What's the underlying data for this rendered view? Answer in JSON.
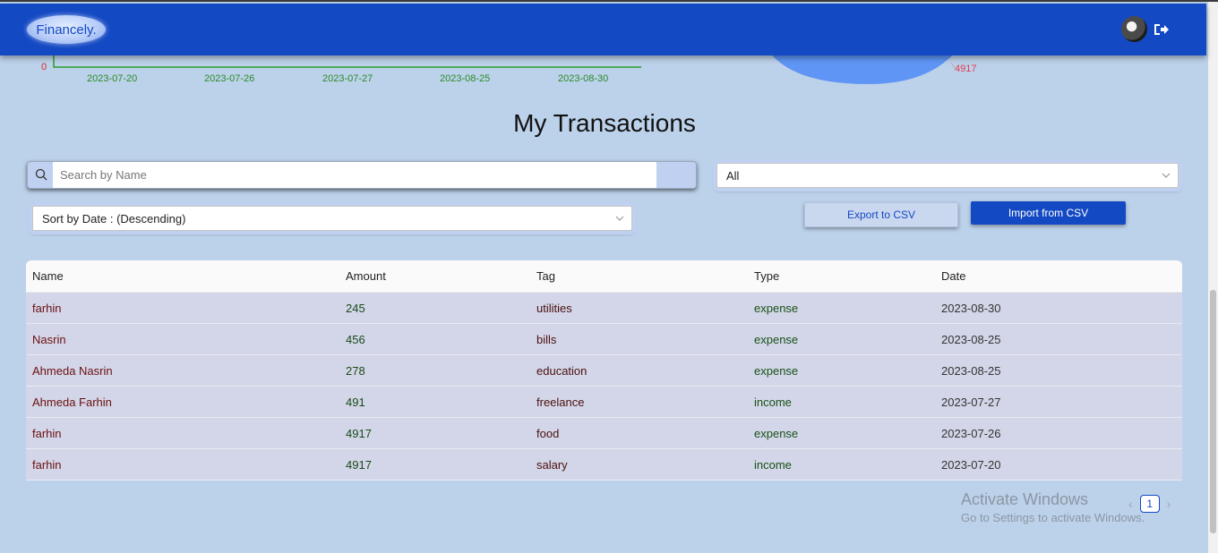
{
  "header": {
    "logo_text": "Financely.",
    "avatar_icon": "user-avatar-icon",
    "logout_icon": "logout-icon",
    "brand_color": "#1449c4"
  },
  "chart_fragment": {
    "y_zero_label": "0",
    "dates": [
      "2023-07-20",
      "2023-07-26",
      "2023-07-27",
      "2023-08-25",
      "2023-08-30"
    ],
    "pie_label": "4917"
  },
  "page_title": "My Transactions",
  "search": {
    "placeholder": "Search by Name",
    "value": ""
  },
  "filter": {
    "selected": "All"
  },
  "sort": {
    "selected": "Sort by Date : (Descending)"
  },
  "buttons": {
    "export": "Export to CSV",
    "import": "Import from CSV"
  },
  "table": {
    "headers": [
      "Name",
      "Amount",
      "Tag",
      "Type",
      "Date"
    ],
    "rows": [
      [
        "farhin",
        "245",
        "utilities",
        "expense",
        "2023-08-30"
      ],
      [
        "Nasrin",
        "456",
        "bills",
        "expense",
        "2023-08-25"
      ],
      [
        "Ahmeda Nasrin",
        "278",
        "education",
        "expense",
        "2023-08-25"
      ],
      [
        "Ahmeda Farhin",
        "491",
        "freelance",
        "income",
        "2023-07-27"
      ],
      [
        "farhin",
        "4917",
        "food",
        "expense",
        "2023-07-26"
      ],
      [
        "farhin",
        "4917",
        "salary",
        "income",
        "2023-07-20"
      ]
    ]
  },
  "pagination": {
    "current_page": "1",
    "prev": "‹",
    "next": "›"
  },
  "watermark": {
    "title": "Activate Windows",
    "subtitle": "Go to Settings to activate Windows."
  }
}
